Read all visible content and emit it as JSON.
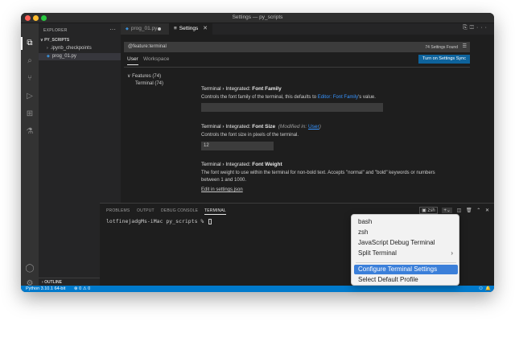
{
  "window": {
    "title": "Settings — py_scripts"
  },
  "sidebar": {
    "header": "EXPLORER",
    "folder": "PY_SCRIPTS",
    "items": [
      {
        "label": ".ipynb_checkpoints"
      },
      {
        "label": "prog_01.py"
      }
    ],
    "outline": "OUTLINE"
  },
  "tabs": [
    {
      "label": "prog_01.py"
    },
    {
      "label": "Settings"
    }
  ],
  "settings": {
    "search_value": "@feature:terminal",
    "found": "74 Settings Found",
    "scope_user": "User",
    "scope_workspace": "Workspace",
    "sync_button": "Turn on Settings Sync",
    "toc": {
      "features": "Features (74)",
      "terminal": "Terminal (74)"
    },
    "items": [
      {
        "prefix": "Terminal › Integrated: ",
        "name": "Font Family",
        "desc_before": "Controls the font family of the terminal, this defaults to ",
        "desc_link1": "Editor: Font Family",
        "desc_after": "'s value.",
        "value": ""
      },
      {
        "prefix": "Terminal › Integrated: ",
        "name": "Font Size",
        "modified_prefix": "(Modified in: ",
        "modified_link": "User",
        "modified_suffix": ")",
        "desc": "Controls the font size in pixels of the terminal.",
        "value": "12"
      },
      {
        "prefix": "Terminal › Integrated: ",
        "name": "Font Weight",
        "desc": "The font weight to use within the terminal for non-bold text. Accepts \"normal\" and \"bold\" keywords or numbers between 1 and 1000.",
        "link": "Edit in settings.json"
      }
    ]
  },
  "panel": {
    "tabs": [
      "PROBLEMS",
      "OUTPUT",
      "DEBUG CONSOLE",
      "TERMINAL"
    ],
    "shell": "zsh",
    "prompt": "lotfinejadgMs-iMac py_scripts % "
  },
  "menu": {
    "items": [
      "bash",
      "zsh",
      "JavaScript Debug Terminal",
      "Split Terminal",
      "Configure Terminal Settings",
      "Select Default Profile"
    ]
  },
  "statusbar": {
    "python": "Python 3.10.1 64-bit",
    "problems": "⊗ 0 ⚠ 0"
  },
  "colors": {
    "accent": "#007acc",
    "menu_highlight": "#3b7fd9",
    "sync_button": "#0e639c"
  }
}
